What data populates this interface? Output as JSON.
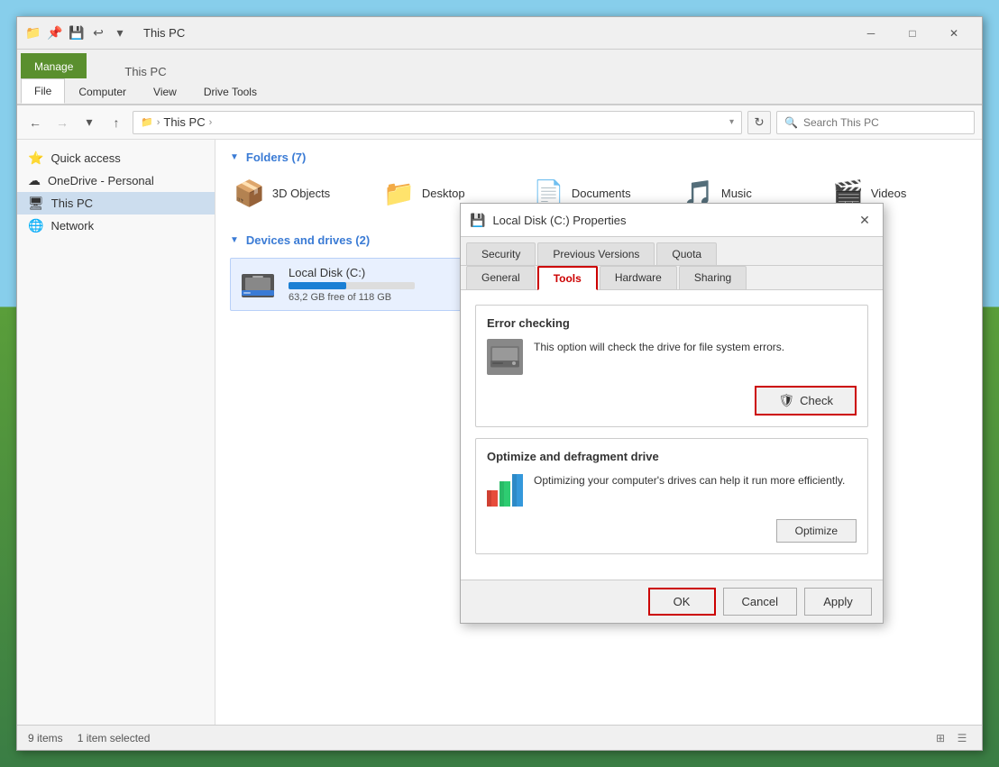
{
  "window": {
    "title": "This PC",
    "ribbon_tabs": [
      {
        "id": "file",
        "label": "File",
        "active": true
      },
      {
        "id": "computer",
        "label": "Computer",
        "active": false
      },
      {
        "id": "view",
        "label": "View",
        "active": false
      },
      {
        "id": "drive_tools",
        "label": "Drive Tools",
        "active": false
      }
    ],
    "manage_label": "Manage"
  },
  "address_bar": {
    "path_root": "This PC",
    "search_placeholder": "Search This PC",
    "back_disabled": false,
    "forward_disabled": false
  },
  "sidebar": {
    "items": [
      {
        "id": "quick-access",
        "label": "Quick access",
        "icon": "⭐"
      },
      {
        "id": "onedrive",
        "label": "OneDrive - Personal",
        "icon": "☁"
      },
      {
        "id": "this-pc",
        "label": "This PC",
        "icon": "🖥",
        "selected": true
      },
      {
        "id": "network",
        "label": "Network",
        "icon": "🌐"
      }
    ]
  },
  "file_area": {
    "folders_header": "Folders (7)",
    "folders": [
      {
        "name": "3D Objects",
        "icon": "📦"
      },
      {
        "name": "Desktop",
        "icon": "📁"
      },
      {
        "name": "Documents",
        "icon": "📄"
      },
      {
        "name": "Music",
        "icon": "🎵"
      },
      {
        "name": "Videos",
        "icon": "🎬"
      }
    ],
    "drives_header": "Devices and drives (2)",
    "drives": [
      {
        "name": "Local Disk (C:)",
        "free": "63,2 GB free of 118 GB",
        "fill_percent": 46
      }
    ]
  },
  "status_bar": {
    "item_count": "9 items",
    "selected": "1 item selected"
  },
  "dialog": {
    "title": "Local Disk (C:) Properties",
    "tabs": [
      {
        "id": "general",
        "label": "General"
      },
      {
        "id": "tools",
        "label": "Tools",
        "active": true
      },
      {
        "id": "hardware",
        "label": "Hardware"
      },
      {
        "id": "sharing",
        "label": "Sharing"
      },
      {
        "id": "security",
        "label": "Security"
      },
      {
        "id": "previous_versions",
        "label": "Previous Versions"
      },
      {
        "id": "quota",
        "label": "Quota"
      }
    ],
    "error_checking": {
      "title": "Error checking",
      "description": "This option will check the drive for file system errors.",
      "button_label": "Check"
    },
    "optimize": {
      "title": "Optimize and defragment drive",
      "description": "Optimizing your computer's drives can help it run more efficiently.",
      "button_label": "Optimize"
    },
    "footer": {
      "ok_label": "OK",
      "cancel_label": "Cancel",
      "apply_label": "Apply"
    }
  }
}
